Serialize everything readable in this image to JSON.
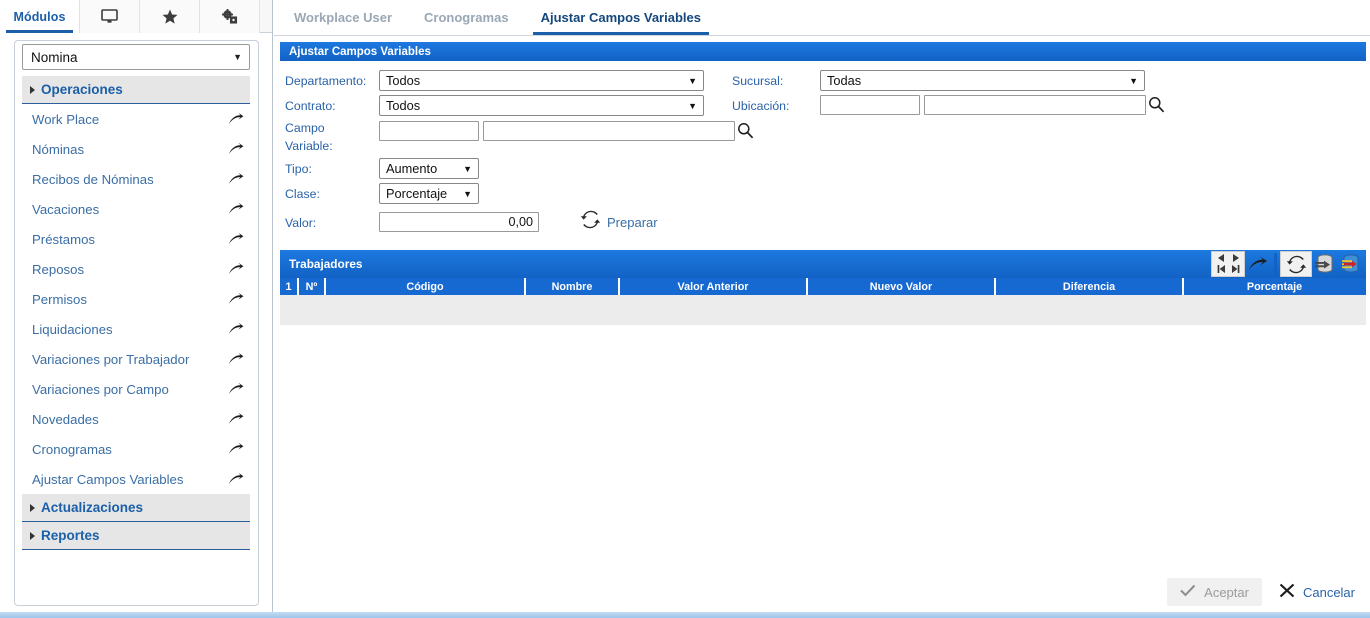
{
  "left_panel": {
    "tabs": [
      {
        "label": "Módulos",
        "icon": "",
        "active": true
      },
      {
        "label": "",
        "icon": "monitor-icon",
        "active": false
      },
      {
        "label": "",
        "icon": "star-icon",
        "active": false
      },
      {
        "label": "",
        "icon": "gears-icon",
        "active": false
      }
    ],
    "module_select": {
      "value": "Nomina"
    },
    "sections": [
      {
        "label": "Operaciones",
        "expanded": true
      },
      {
        "label": "Actualizaciones",
        "expanded": false
      },
      {
        "label": "Reportes",
        "expanded": false
      }
    ],
    "menu_items": [
      "Work Place",
      "Nóminas",
      "Recibos de Nóminas",
      "Vacaciones",
      "Préstamos",
      "Reposos",
      "Permisos",
      "Liquidaciones",
      "Variaciones por Trabajador",
      "Variaciones por Campo",
      "Novedades",
      "Cronogramas",
      "Ajustar Campos Variables"
    ]
  },
  "top_tabs": [
    {
      "label": "Workplace User",
      "active": false
    },
    {
      "label": "Cronogramas",
      "active": false
    },
    {
      "label": "Ajustar Campos Variables",
      "active": true
    }
  ],
  "form": {
    "section_title": "Ajustar Campos Variables",
    "departamento": {
      "label": "Departamento:",
      "value": "Todos"
    },
    "sucursal": {
      "label": "Sucursal:",
      "value": "Todas"
    },
    "contrato": {
      "label": "Contrato:",
      "value": "Todos"
    },
    "ubicacion": {
      "label": "Ubicación:",
      "code": "",
      "name": ""
    },
    "campo_variable": {
      "label_line1": "Campo",
      "label_line2": "Variable:",
      "code": "",
      "name": ""
    },
    "tipo": {
      "label": "Tipo:",
      "value": "Aumento"
    },
    "clase": {
      "label": "Clase:",
      "value": "Porcentaje"
    },
    "valor": {
      "label": "Valor:",
      "value": "0,00"
    },
    "preparar": {
      "label": "Preparar"
    }
  },
  "grid": {
    "title": "Trabajadores",
    "columns": [
      "1",
      "Nº",
      "Código",
      "Nombre",
      "Valor Anterior",
      "Nuevo Valor",
      "Diferencia",
      "Porcentaje"
    ],
    "rows": [],
    "toolbar": {
      "prev": "prev-arrow-icon",
      "next": "next-arrow-icon",
      "first": "first-record-icon",
      "last": "last-record-icon",
      "export": "export-arrow-icon",
      "refresh": "refresh-icon",
      "db_save": "database-save-icon",
      "db_delete": "database-delete-icon"
    }
  },
  "footer": {
    "accept": {
      "label": "Aceptar",
      "enabled": false
    },
    "cancel": {
      "label": "Cancelar",
      "enabled": true
    }
  },
  "colors": {
    "brand_blue": "#1769d2",
    "link_blue": "#3a6ea5",
    "header_blue": "#14477d",
    "disabled_gray": "#9b9b9b"
  }
}
